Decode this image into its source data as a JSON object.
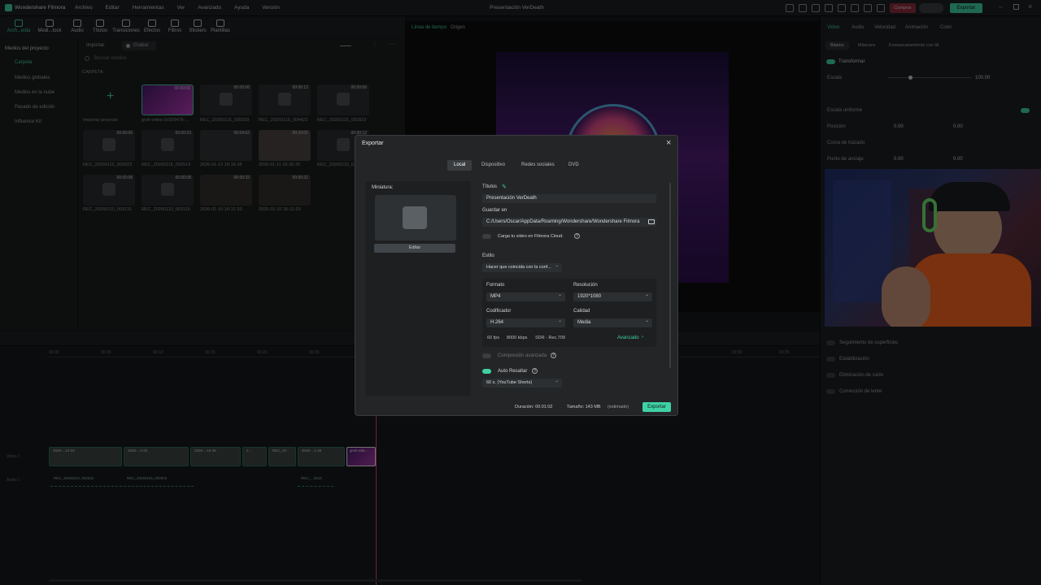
{
  "app": {
    "name": "Wondershare Filmora",
    "project_title": "Presentación VerDeath"
  },
  "menu": [
    "Archivo",
    "Editar",
    "Herramientas",
    "Ver",
    "Avanzado",
    "Ayuda",
    "Versión"
  ],
  "titlebar": {
    "comprar_label": "Comprar",
    "export_label": "Exportar"
  },
  "toolbar": [
    {
      "label": "Arch...edia",
      "active": true
    },
    {
      "label": "Medi...tock",
      "active": false
    },
    {
      "label": "Audio",
      "active": false
    },
    {
      "label": "Títulos",
      "active": false
    },
    {
      "label": "Transiciones",
      "active": false
    },
    {
      "label": "Efectos",
      "active": false
    },
    {
      "label": "Filtros",
      "active": false
    },
    {
      "label": "Stickers",
      "active": false
    },
    {
      "label": "Plantillas",
      "active": false
    }
  ],
  "sidebar": {
    "items": [
      "Medios del proyecto",
      "Carpeta",
      "Medios globales",
      "Medios en la nube",
      "Pasado de edición",
      "Influence Kit"
    ]
  },
  "media": {
    "import_label": "Importar",
    "record_label": "Grabar",
    "search_placeholder": "Buscar medios",
    "folder_label": "CARPETA",
    "import_project_label": "Importar proyecto",
    "items": [
      {
        "name": "grok-video-3c929476-...",
        "duration": "00:00:06"
      },
      {
        "name": "REC_20260115_005518",
        "duration": "00:00:06"
      },
      {
        "name": "REC_20260115_004423",
        "duration": "00:00:12"
      },
      {
        "name": "REC_20260115_002823",
        "duration": "00:00:06"
      },
      {
        "name": "REC_20260115_002823",
        "duration": "00:00:06"
      },
      {
        "name": "REC_20260115_002514",
        "duration": "00:00:03"
      },
      {
        "name": "2026-01-12 18-16-36",
        "duration": "00:04:02"
      },
      {
        "name": "2026-01-11 16-30-35",
        "duration": "00:10:01"
      },
      {
        "name": "REC_20260110_0...",
        "duration": "00:00:12"
      },
      {
        "name": "REC_20260110_003131",
        "duration": "00:00:08"
      },
      {
        "name": "REC_20260110_003116",
        "duration": "00:00:08"
      },
      {
        "name": "2026-01-10 18-12-33",
        "duration": "00:00:32"
      },
      {
        "name": "2026-01-10 18-12-33",
        "duration": "00:00:32"
      }
    ]
  },
  "preview": {
    "tabs": [
      "Línea de tiempo",
      "Origen"
    ]
  },
  "right_panel": {
    "tabs": [
      "Video",
      "Audio",
      "Velocidad",
      "Animación",
      "Color"
    ],
    "subtabs": [
      "Básico",
      "Máscara",
      "Enmascaramiento con IA"
    ],
    "transform_label": "Transformar",
    "scale_label": "Escala",
    "scale_value": "100.00",
    "uniform_scale_label": "Escala uniforme",
    "position_label": "Posición",
    "pos_x": "0.00",
    "pos_y": "0.00",
    "path_curve_label": "Curva de trazado",
    "anchor_label": "Punto de anclaje",
    "anchor_x": "0.00",
    "anchor_y": "0.00",
    "features": [
      "Seguimiento de superficies",
      "Estabilización",
      "Eliminación de ruido",
      "Corrección de lente"
    ]
  },
  "timeline": {
    "ruler": [
      "00:00",
      "00:05",
      "00:10",
      "00:15",
      "00:20",
      "00:25",
      "00:30",
      "00:35",
      "00:40"
    ],
    "track_video": "Video 1",
    "track_audio": "Audio 1",
    "video_clips": [
      "00_20...",
      "2026-...13-33",
      "2026-...3-33",
      "2026-...16-36",
      "2...",
      "REC_20...",
      "2026-...1-35",
      "grok-vide..."
    ],
    "audio_clips": [
      "REC_20260110_003342",
      "REC_20260115_002823",
      "REC_...2518"
    ]
  },
  "export_dialog": {
    "title": "Exportar",
    "tabs": [
      "Local",
      "Dispositivo",
      "Redes sociales",
      "DVD"
    ],
    "active_tab": "Local",
    "thumbnail_label": "Miniatura:",
    "edit_label": "Editar",
    "title_label": "Títulos",
    "title_value": "Presentación VerDeath",
    "save_label": "Guardar en",
    "save_path": "C:/Users/Oscar/AppData/Roaming/Wondershare/Wondershare Filmora",
    "cloud_label": "Carga tu video en Filmora Cloud.",
    "style_label": "Estilo",
    "style_value": "Hacer que coincida con la conf...",
    "format_label": "Formato",
    "format_value": "MP4",
    "resolution_label": "Resolución",
    "resolution_value": "1920*1080",
    "encoder_label": "Codificador",
    "encoder_value": "H.264",
    "quality_label": "Calidad",
    "quality_value": "Media",
    "fps": "60 fps",
    "bitrate": "8000 kbps",
    "color": "SDR - Rec.709",
    "advanced_label": "Avanzado",
    "compression_label": "Compresión avanzada",
    "autohighlight_label": "Auto Resaltar",
    "autohighlight_value": "60 s. (YouTube Shorts)",
    "duration_label": "Duración: 00:01:02",
    "size_label": "Tamaño: 143 MB",
    "estimated_label": "(estimado)",
    "export_button": "Exportar"
  },
  "colors": {
    "accent": "#3fd1a4",
    "record": "#e0428a"
  }
}
